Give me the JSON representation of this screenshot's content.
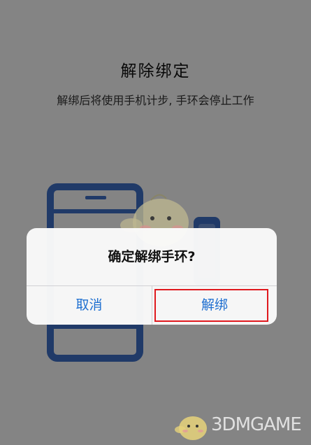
{
  "page": {
    "title": "解除绑定",
    "subtitle": "解绑后将使用手机计步, 手环会停止工作"
  },
  "dialog": {
    "message": "确定解绑手环?",
    "cancel_label": "取消",
    "confirm_label": "解绑"
  },
  "watermark": {
    "text": "3DMGAME"
  },
  "colors": {
    "accent": "#1e6fd0",
    "highlight": "#e0191e",
    "illustration": "#3e6fc4"
  }
}
